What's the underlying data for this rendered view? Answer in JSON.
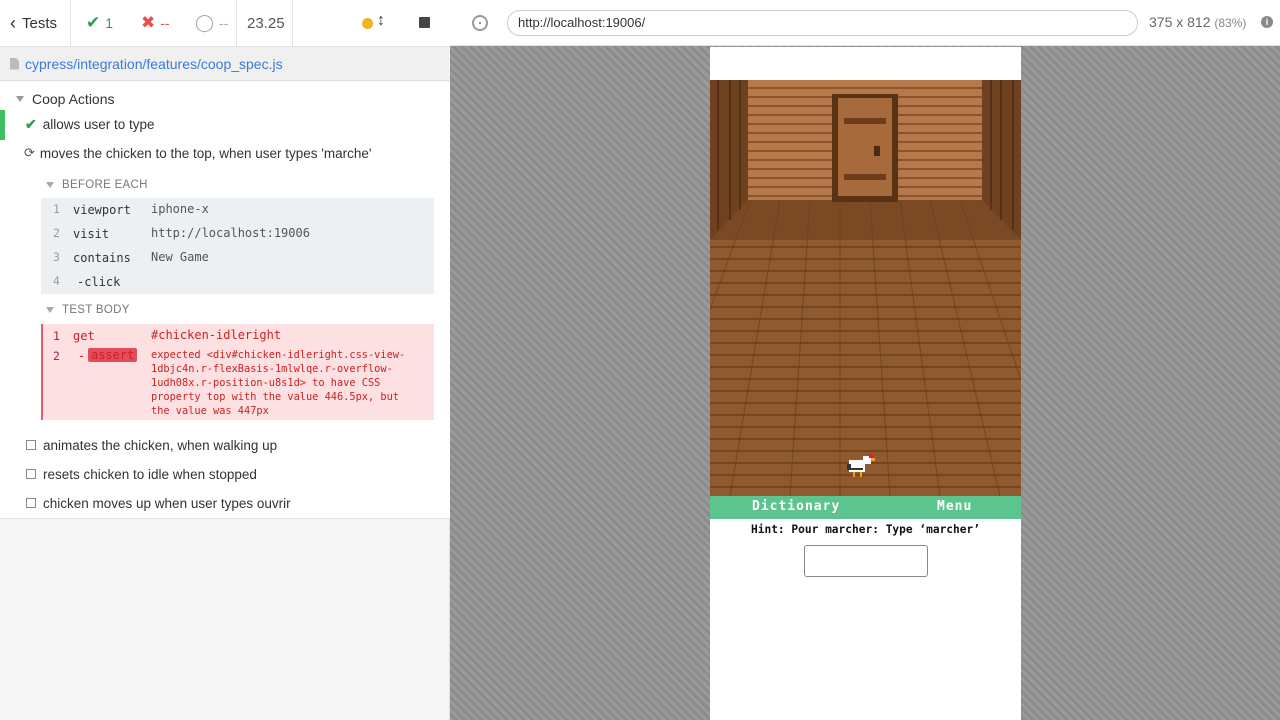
{
  "stats": {
    "tests_label": "Tests",
    "passed": "1",
    "failed": "--",
    "pending": "--",
    "duration": "23.25"
  },
  "spec_path": "cypress/integration/features/coop_spec.js",
  "suite": {
    "title": "Coop Actions",
    "tests": {
      "t1": "allows user to type",
      "t2": "moves the chicken to the top, when user types 'marche'",
      "t3": "animates the chicken, when walking up",
      "t4": "resets chicken to idle when stopped",
      "t5": "chicken moves up when user types ouvrir"
    }
  },
  "before_each": {
    "label": "BEFORE EACH",
    "commands": [
      {
        "num": "1",
        "name": "viewport",
        "msg": "iphone-x"
      },
      {
        "num": "2",
        "name": "visit",
        "msg": "http://localhost:19006"
      },
      {
        "num": "3",
        "name": "contains",
        "msg": "New Game"
      },
      {
        "num": "4",
        "name": "-click",
        "msg": ""
      }
    ]
  },
  "test_body": {
    "label": "TEST BODY",
    "cmd1": {
      "num": "1",
      "name": "get",
      "msg": "#chicken-idleright"
    },
    "cmd2": {
      "num": "2",
      "prefix": "-",
      "name": "assert",
      "msg": "expected <div#chicken-idleright.css-view-1dbjc4n.r-flexBasis-1mlwlqe.r-overflow-1udh08x.r-position-u8s1d> to have CSS property top with the value 446.5px, but the value was 447px"
    }
  },
  "aut": {
    "url": "http://localhost:19006/",
    "viewport": "375 x 812",
    "scale": "(83%)"
  },
  "game": {
    "dictionary": "Dictionary",
    "menu": "Menu",
    "hint": "Hint: Pour marcher: Type ‘marcher’"
  },
  "colors": {
    "passed": "#2ba24c",
    "failed": "#e94f4f",
    "running": "#f5b21a",
    "link": "#3a7ad9",
    "game_bar": "#5cc48e"
  }
}
